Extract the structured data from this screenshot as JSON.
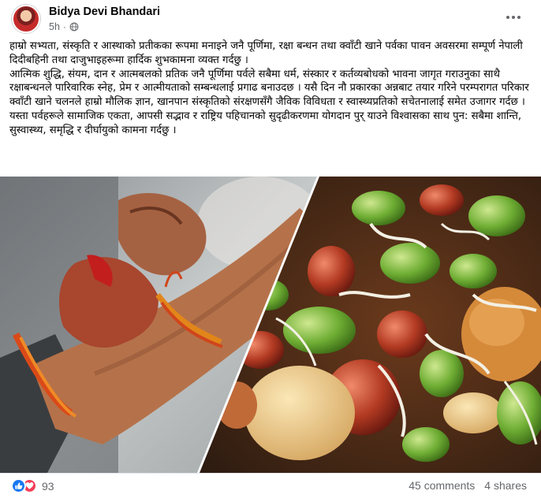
{
  "post": {
    "author": "Bidya Devi Bhandari",
    "time": "5h",
    "meta_separator": "·",
    "paragraphs": [
      "हाम्रो सभ्यता, संस्कृति र आस्थाको प्रतीकका रूपमा मनाइने जनै पूर्णिमा, रक्षा बन्धन तथा क्वाँटी खाने पर्वका पावन अवसरमा सम्पूर्ण नेपाली दिदीबहिनी तथा दाजुभाइहरूमा हार्दिक शुभकामना व्यक्त गर्दछु ।",
      "आत्मिक शुद्धि, संयम, दान र आत्मबलको प्रतिक जनै पूर्णिमा पर्वले सबैमा धर्म, संस्कार र कर्तव्यबोधको भावना जागृत गराउनुका साथै रक्षाबन्धनले पारिवारिक स्नेह, प्रेम र आत्मीयताको सम्बन्धलाई प्रगाढ बनाउदछ । यसै दिन नौ प्रकारका अन्नबाट तयार गरिने परम्परागत परिकार क्वाँटी खाने चलनले हाम्रो मौलिक ज्ञान, खानपान संस्कृतिको संरक्षणसँगै जैविक विविधता र स्वास्थ्यप्रतिको सचेतनालाई समेत उजागर गर्दछ ।",
      "यस्ता पर्वहरूले सामाजिक एकता, आपसी सद्भाव र राष्ट्रिय पहिचानको सुदृढीकरणमा योगदान पुर् याउने विश्वासका साथ पुन: सबैमा शान्ति, सुस्वास्थ्य, समृद्धि र दीर्घायुको कामना गर्दछु ।"
    ]
  },
  "footer": {
    "reaction_count": "93",
    "comments": "45 comments",
    "shares": "4 shares"
  },
  "icons": {
    "like": "like-icon",
    "love": "love-icon",
    "globe": "globe-icon",
    "more": "more-options-icon"
  },
  "colors": {
    "like_blue": "#1877f2",
    "love_red": "#f33e58",
    "meta_gray": "#65676b"
  }
}
